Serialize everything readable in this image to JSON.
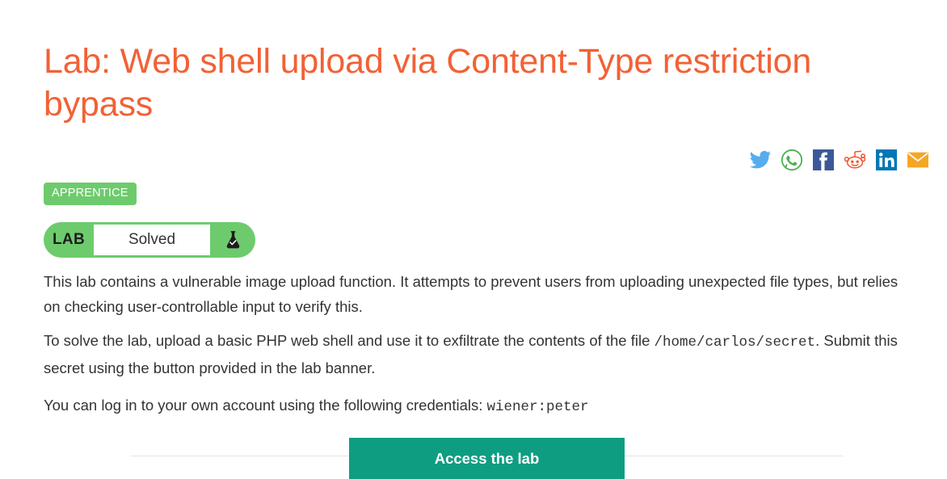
{
  "page": {
    "title": "Lab: Web shell upload via Content-Type restriction bypass",
    "background_color": "#ffffff",
    "title_color": "#f26135",
    "text_color": "#333333"
  },
  "share": {
    "icons": [
      {
        "name": "twitter-icon",
        "label": "Twitter",
        "color": "#55acee"
      },
      {
        "name": "whatsapp-icon",
        "label": "WhatsApp",
        "color": "#4caf50"
      },
      {
        "name": "facebook-icon",
        "label": "Facebook",
        "color": "#3b5998"
      },
      {
        "name": "reddit-icon",
        "label": "Reddit",
        "color": "#f2552c"
      },
      {
        "name": "linkedin-icon",
        "label": "LinkedIn",
        "color": "#0077b5"
      },
      {
        "name": "email-icon",
        "label": "Email",
        "color": "#f5a623"
      }
    ]
  },
  "difficulty": {
    "label": "APPRENTICE",
    "background_color": "#6dcb6d",
    "text_color": "#ffffff"
  },
  "lab_banner": {
    "tag": "LAB",
    "status": "Solved",
    "flask_icon": "flask-check-icon",
    "background_color": "#6dcb6d",
    "status_background": "#ffffff"
  },
  "description": {
    "paragraph_1": "This lab contains a vulnerable image upload function. It attempts to prevent users from uploading unexpected file types, but relies on checking user-controllable input to verify this.",
    "paragraph_2_before": "To solve the lab, upload a basic PHP web shell and use it to exfiltrate the contents of the file ",
    "paragraph_2_code": "/home/carlos/secret",
    "paragraph_2_after": ". Submit this secret using the button provided in the lab banner.",
    "paragraph_3_before": "You can log in to your own account using the following credentials: ",
    "paragraph_3_code": "wiener:peter"
  },
  "footer": {
    "access_button_label": "Access the lab",
    "access_button_color": "#0f9d82",
    "divider_color": "#e4e4e4"
  }
}
